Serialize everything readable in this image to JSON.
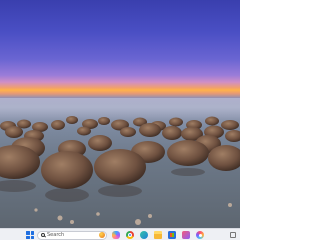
{
  "wallpaper": {
    "scene": "seaside-sunset-with-boulders",
    "colors": {
      "sky_top": "#3a3fae",
      "horizon": "#ffb24a",
      "water": "#8f8fb4",
      "rock": "#7a5a44"
    }
  },
  "taskbar": {
    "background": "#eef0f4",
    "start_icon": "windows-icon",
    "search": {
      "placeholder": "Search",
      "icon": "search-icon",
      "badge_icon": "bing-icon"
    },
    "pinned": [
      {
        "name": "copilot-icon"
      },
      {
        "name": "chrome-icon"
      },
      {
        "name": "edge-icon"
      },
      {
        "name": "file-explorer-icon"
      },
      {
        "name": "microsoft-store-icon"
      },
      {
        "name": "media-player-icon"
      },
      {
        "name": "photos-icon"
      }
    ],
    "tray_icon": "show-desktop-icon"
  }
}
